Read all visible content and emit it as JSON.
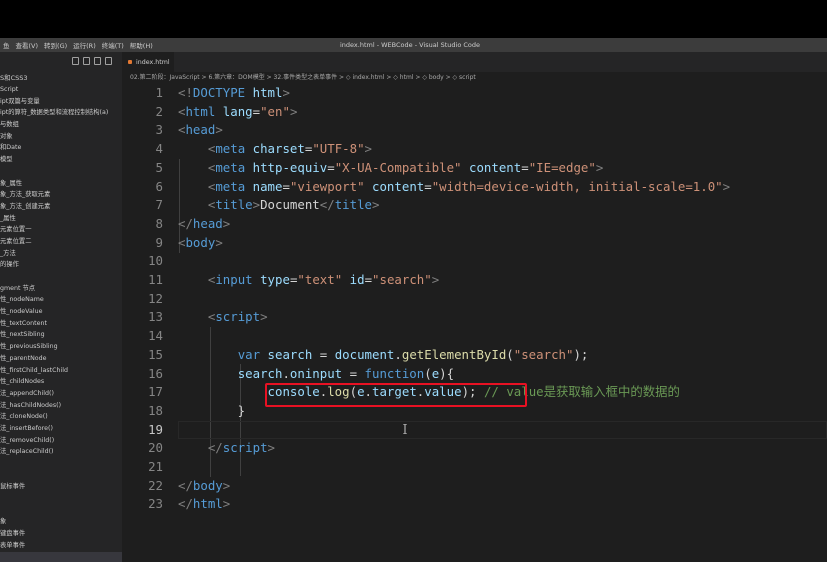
{
  "window": {
    "title": "index.html - WEBCode - Visual Studio Code",
    "menu": [
      "鱼",
      "查看(V)",
      "转到(G)",
      "运行(R)",
      "终端(T)",
      "帮助(H)"
    ]
  },
  "sidebar": {
    "project": "S和CSS3",
    "items": [
      "Script",
      "ipt双篇与变量",
      "ipt的算符_数据类型和流程控制结构(a)",
      "与数组",
      "对象",
      "和Date",
      "模型",
      "",
      "象_属性",
      "象_方法_获取元素",
      "象_方法_创建元素",
      "_属性",
      "元素位置一",
      "元素位置二",
      "_方法",
      "的操作",
      "",
      "gment 节点",
      "性_nodeName",
      "性_nodeValue",
      "性_textContent",
      "性_nextSibling",
      "性_previousSibling",
      "性_parentNode",
      "性_firstChild_lastChild",
      "性_childNodes",
      "法_appendChild()",
      "法_hasChildNodes()",
      "法_cloneNode()",
      "法_insertBefore()",
      "法_removeChild()",
      "法_replaceChild()",
      "",
      "",
      "鼠标事件",
      "",
      "",
      "象",
      "键盘事件",
      "表单事件"
    ]
  },
  "editor": {
    "tab_label": "index.html",
    "breadcrumb": "02.第二阶段：JavaScript > 6.第六章：DOM模型 > 32.事件类型之表单事件 > ◇ index.html > ◇ html > ◇ body > ◇ script",
    "active_line": 19,
    "lines": [
      {
        "n": 1,
        "segs": [
          [
            "t",
            "<!"
          ],
          [
            "tg",
            "DOCTYPE"
          ],
          [
            "tx",
            " "
          ],
          [
            "at",
            "html"
          ],
          [
            "t",
            ">"
          ]
        ]
      },
      {
        "n": 2,
        "segs": [
          [
            "t",
            "<"
          ],
          [
            "tg",
            "html"
          ],
          [
            "tx",
            " "
          ],
          [
            "at",
            "lang"
          ],
          [
            "tx",
            "="
          ],
          [
            "st",
            "\"en\""
          ],
          [
            "t",
            ">"
          ]
        ]
      },
      {
        "n": 3,
        "segs": [
          [
            "t",
            "<"
          ],
          [
            "tg",
            "head"
          ],
          [
            "t",
            ">"
          ]
        ]
      },
      {
        "n": 4,
        "segs": [
          [
            "tx",
            "    "
          ],
          [
            "t",
            "<"
          ],
          [
            "tg",
            "meta"
          ],
          [
            "tx",
            " "
          ],
          [
            "at",
            "charset"
          ],
          [
            "tx",
            "="
          ],
          [
            "st",
            "\"UTF-8\""
          ],
          [
            "t",
            ">"
          ]
        ]
      },
      {
        "n": 5,
        "segs": [
          [
            "tx",
            "    "
          ],
          [
            "t",
            "<"
          ],
          [
            "tg",
            "meta"
          ],
          [
            "tx",
            " "
          ],
          [
            "at",
            "http-equiv"
          ],
          [
            "tx",
            "="
          ],
          [
            "st",
            "\"X-UA-Compatible\""
          ],
          [
            "tx",
            " "
          ],
          [
            "at",
            "content"
          ],
          [
            "tx",
            "="
          ],
          [
            "st",
            "\"IE=edge\""
          ],
          [
            "t",
            ">"
          ]
        ]
      },
      {
        "n": 6,
        "segs": [
          [
            "tx",
            "    "
          ],
          [
            "t",
            "<"
          ],
          [
            "tg",
            "meta"
          ],
          [
            "tx",
            " "
          ],
          [
            "at",
            "name"
          ],
          [
            "tx",
            "="
          ],
          [
            "st",
            "\"viewport\""
          ],
          [
            "tx",
            " "
          ],
          [
            "at",
            "content"
          ],
          [
            "tx",
            "="
          ],
          [
            "st",
            "\"width=device-width, initial-scale=1.0\""
          ],
          [
            "t",
            ">"
          ]
        ]
      },
      {
        "n": 7,
        "segs": [
          [
            "tx",
            "    "
          ],
          [
            "t",
            "<"
          ],
          [
            "tg",
            "title"
          ],
          [
            "t",
            ">"
          ],
          [
            "tx",
            "Document"
          ],
          [
            "t",
            "</"
          ],
          [
            "tg",
            "title"
          ],
          [
            "t",
            ">"
          ]
        ]
      },
      {
        "n": 8,
        "segs": [
          [
            "t",
            "</"
          ],
          [
            "tg",
            "head"
          ],
          [
            "t",
            ">"
          ]
        ]
      },
      {
        "n": 9,
        "segs": [
          [
            "t",
            "<"
          ],
          [
            "tg",
            "body"
          ],
          [
            "t",
            ">"
          ]
        ]
      },
      {
        "n": 10,
        "segs": []
      },
      {
        "n": 11,
        "segs": [
          [
            "tx",
            "    "
          ],
          [
            "t",
            "<"
          ],
          [
            "tg",
            "input"
          ],
          [
            "tx",
            " "
          ],
          [
            "at",
            "type"
          ],
          [
            "tx",
            "="
          ],
          [
            "st",
            "\"text\""
          ],
          [
            "tx",
            " "
          ],
          [
            "at",
            "id"
          ],
          [
            "tx",
            "="
          ],
          [
            "st",
            "\"search\""
          ],
          [
            "t",
            ">"
          ]
        ]
      },
      {
        "n": 12,
        "segs": []
      },
      {
        "n": 13,
        "segs": [
          [
            "tx",
            "    "
          ],
          [
            "t",
            "<"
          ],
          [
            "tg",
            "script"
          ],
          [
            "t",
            ">"
          ]
        ]
      },
      {
        "n": 14,
        "segs": []
      },
      {
        "n": 15,
        "segs": [
          [
            "tx",
            "        "
          ],
          [
            "kw",
            "var"
          ],
          [
            "tx",
            " "
          ],
          [
            "vr",
            "search"
          ],
          [
            "tx",
            " = "
          ],
          [
            "vr",
            "document"
          ],
          [
            "tx",
            "."
          ],
          [
            "fn",
            "getElementById"
          ],
          [
            "tx",
            "("
          ],
          [
            "st",
            "\"search\""
          ],
          [
            "tx",
            ");"
          ]
        ]
      },
      {
        "n": 16,
        "segs": [
          [
            "tx",
            "        "
          ],
          [
            "vr",
            "search"
          ],
          [
            "tx",
            "."
          ],
          [
            "vr",
            "oninput"
          ],
          [
            "tx",
            " = "
          ],
          [
            "kw",
            "function"
          ],
          [
            "tx",
            "("
          ],
          [
            "vr",
            "e"
          ],
          [
            "tx",
            "){"
          ]
        ]
      },
      {
        "n": 17,
        "segs": [
          [
            "tx",
            "            "
          ],
          [
            "vr",
            "console"
          ],
          [
            "tx",
            "."
          ],
          [
            "fn",
            "log"
          ],
          [
            "tx",
            "("
          ],
          [
            "vr",
            "e"
          ],
          [
            "tx",
            "."
          ],
          [
            "vr",
            "target"
          ],
          [
            "tx",
            "."
          ],
          [
            "vr",
            "value"
          ],
          [
            "tx",
            "); "
          ],
          [
            "cm",
            "// value是获取输入框中的数据的"
          ]
        ]
      },
      {
        "n": 18,
        "segs": [
          [
            "tx",
            "        }"
          ]
        ]
      },
      {
        "n": 19,
        "segs": []
      },
      {
        "n": 20,
        "segs": [
          [
            "tx",
            "    "
          ],
          [
            "t",
            "</"
          ],
          [
            "tg",
            "script"
          ],
          [
            "t",
            ">"
          ]
        ]
      },
      {
        "n": 21,
        "segs": []
      },
      {
        "n": 22,
        "segs": [
          [
            "t",
            "</"
          ],
          [
            "tg",
            "body"
          ],
          [
            "t",
            ">"
          ]
        ]
      },
      {
        "n": 23,
        "segs": [
          [
            "t",
            "</"
          ],
          [
            "tg",
            "html"
          ],
          [
            "t",
            ">"
          ]
        ]
      }
    ]
  },
  "colors": {
    "highlight_box": "#e81123",
    "editor_bg": "#1e1e1e",
    "sidebar_bg": "#252526"
  }
}
